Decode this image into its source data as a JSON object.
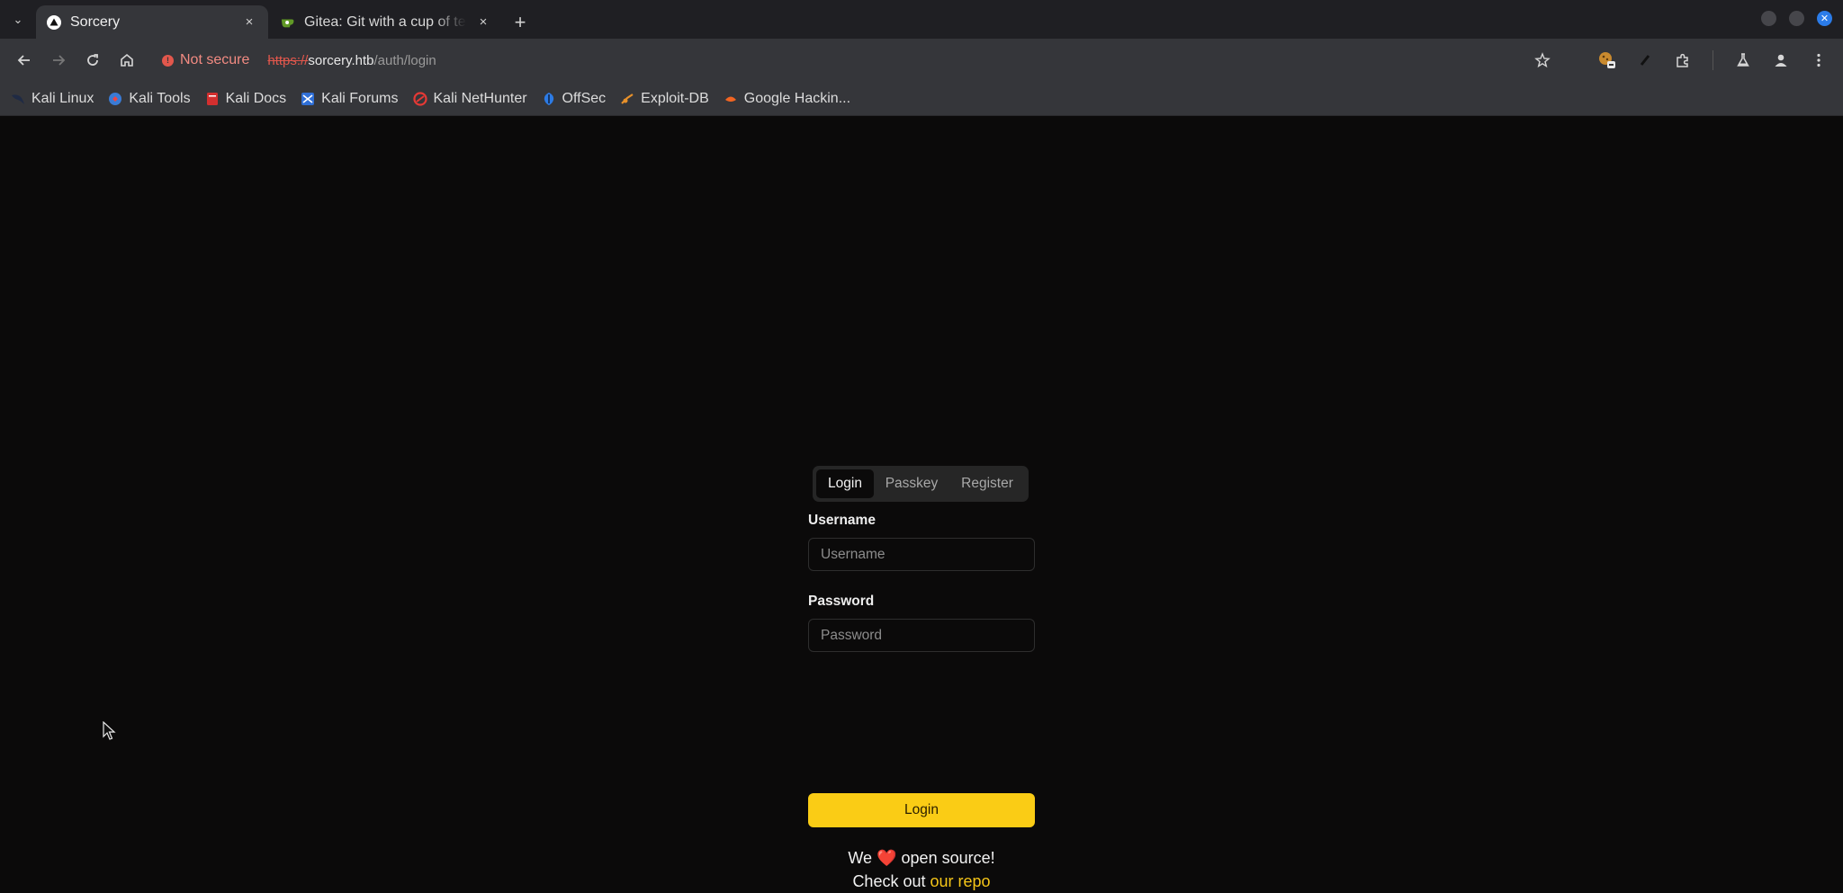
{
  "tabs": [
    {
      "title": "Sorcery",
      "active": true,
      "close": "×"
    },
    {
      "title": "Gitea: Git with a cup of tea",
      "active": false,
      "close": "×"
    }
  ],
  "tabstrip": {
    "new_tab": "+",
    "search": "⌄"
  },
  "toolbar": {
    "security_label": "Not secure",
    "url_scheme": "https://",
    "url_host": "sorcery.htb",
    "url_path": "/auth/login"
  },
  "bookmarks": [
    {
      "label": "Kali Linux",
      "icon": "kali-dragon-icon"
    },
    {
      "label": "Kali Tools",
      "icon": "kali-tools-icon"
    },
    {
      "label": "Kali Docs",
      "icon": "kali-docs-icon"
    },
    {
      "label": "Kali Forums",
      "icon": "kali-forums-icon"
    },
    {
      "label": "Kali NetHunter",
      "icon": "nethunter-icon"
    },
    {
      "label": "OffSec",
      "icon": "offsec-icon"
    },
    {
      "label": "Exploit-DB",
      "icon": "exploit-db-icon"
    },
    {
      "label": "Google Hackin...",
      "icon": "ghdb-icon"
    }
  ],
  "auth": {
    "tabs": [
      {
        "label": "Login",
        "active": true
      },
      {
        "label": "Passkey",
        "active": false
      },
      {
        "label": "Register",
        "active": false
      }
    ],
    "username_label": "Username",
    "username_placeholder": "Username",
    "password_label": "Password",
    "password_placeholder": "Password",
    "submit_label": "Login",
    "note_line1_pre": "We",
    "note_heart": "❤️",
    "note_line1_post": "open source!",
    "note_line2_pre": "Check out",
    "note_link": "our repo"
  },
  "colors": {
    "accent": "#facc15",
    "link": "#f5c518",
    "background": "#0b0a0a",
    "chrome": "#35363a",
    "insecure": "#e2574c"
  }
}
